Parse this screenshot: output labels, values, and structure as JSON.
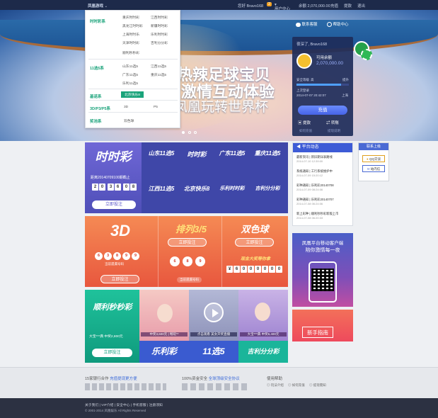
{
  "topbar": {
    "brand": "凤凰游戏",
    "greeting": "您好 Bravo168",
    "user_center": "用户中心",
    "balance": "余额 2,070,000.00",
    "links": [
      "充值",
      "提款",
      "退出"
    ],
    "msg_count": "2"
  },
  "hero": {
    "line1": "热辣足球宝贝",
    "line2": "激情互动体验",
    "line3": "凤凰玩转世界杯",
    "service": "联系客服",
    "help": "帮助中心"
  },
  "menu": {
    "cat1": "时时彩系",
    "cat1_items": [
      "重庆时时彩",
      "江西时时彩",
      "黑龙江时时彩",
      "新疆时时彩",
      "上海时时乐",
      "乐利时时彩",
      "天津时时彩",
      "吉利分分彩",
      "顺利秒秒彩"
    ],
    "cat2": "11选5系",
    "cat2_items": [
      "山东11选5",
      "江西11选5",
      "广东11选5",
      "重庆11选5",
      "乐利11选5"
    ],
    "cat3": "基诺系",
    "cat3_items": [
      "北京快乐8"
    ],
    "cat4": "3D/P3/P5系",
    "cat4_items": [
      "3D",
      "P5"
    ],
    "cat5": "奖池系",
    "cat5_items": [
      "双色球"
    ]
  },
  "login": {
    "welcome": "夜深了, Bravo168",
    "balance_label": "可用余额",
    "balance": "2,070,000.00",
    "security_label": "安全等级",
    "security_level": "高",
    "security_action": "提升",
    "last_login_label": "上次登录",
    "last_login": "2014-07-07 20:42:07",
    "ip_label": "上海",
    "deposit": "充值",
    "withdraw": "提款",
    "transfer": "转账",
    "tab1": "如何充值",
    "tab2": "提现说明"
  },
  "ssc": {
    "logo": "时时彩",
    "issue_text": "距离20140709100期截止",
    "countdown": [
      "2",
      "0",
      "3",
      "6",
      "0",
      "8"
    ],
    "bet": "立即投注",
    "games": [
      "山东11选5",
      "时时彩",
      "广东11选5",
      "重庆11选5",
      "江西11选5",
      "北京快乐8",
      "乐利时时彩",
      "吉利分分彩"
    ]
  },
  "lotto": {
    "logo3d": "3D",
    "balls3d": [
      "6",
      "3",
      "8",
      "9",
      "9"
    ],
    "bet": "立即投注",
    "bet2": "立即投注",
    "bet3": "立即投注",
    "hint": "当前遗漏号码",
    "pl": "排列3/5",
    "pl_balls": [
      "6",
      "8",
      "9"
    ],
    "pl_hint": "当前遗漏号码",
    "ssq": "双色球",
    "ssq_jackpot_label": "现金大奖等你拿",
    "ssq_digits": [
      "¥",
      "6",
      "0",
      "0",
      "0",
      "0",
      "0",
      "0"
    ]
  },
  "games": {
    "mmc": "顺利秒秒彩",
    "mmc_line": "大宝***典 中奖2,800元",
    "mmc_bet": "立即投注",
    "t1": "中奖3,600元 | 畅玩**",
    "t2": "点击观看 美女开奖直播",
    "t3": "大宝***典 中奖6,400元",
    "l1": "乐利彩",
    "l2": "11选5",
    "l3": "吉利分分彩"
  },
  "news": {
    "title": "平台动态",
    "items": [
      {
        "t": "最新资讯 | 新旧期详表路线",
        "d": "2014-07-10 12:39:00"
      },
      {
        "t": "系统通知 | 工行系统维护中",
        "d": "2014-07-09 15:20:12"
      },
      {
        "t": "彩种通知 | 乐利彩20140708",
        "d": "2014-07-09 08:24:06"
      },
      {
        "t": "彩种通知 | 乐利彩20140707",
        "d": "2014-07-08 06:24:06"
      },
      {
        "t": "新上彩种 | 顺利秒秒彩新版上市",
        "d": "2014-07-08 06:20:33"
      }
    ]
  },
  "app": {
    "line1": "凤凰平台移动客户端",
    "line2": "陪你激情每一夜"
  },
  "guide": {
    "label": "新手指南"
  },
  "contact": {
    "title": "联系上级",
    "qq": "QQ交谈",
    "msg": "站内信"
  },
  "footer": {
    "partners_title": "15家银行合作",
    "partners_link": "充值提现更方便",
    "safety_title": "100%资金安全",
    "safety_link": "全球顶级安全协议",
    "help_title": "使用帮助",
    "help_items": [
      "玩法介绍",
      "如何充值",
      "提现需知"
    ],
    "links": [
      "关于我们",
      "VIP介绍",
      "安全中心",
      "手机客服",
      "注册须知"
    ],
    "copyright": "© 2001-2014 凤凰娱乐 All Rights Reserved"
  },
  "colors": {
    "accent": "#1aa37a",
    "purple": "#5a55c8",
    "orange": "#f07a4a",
    "teal": "#18b08e"
  }
}
